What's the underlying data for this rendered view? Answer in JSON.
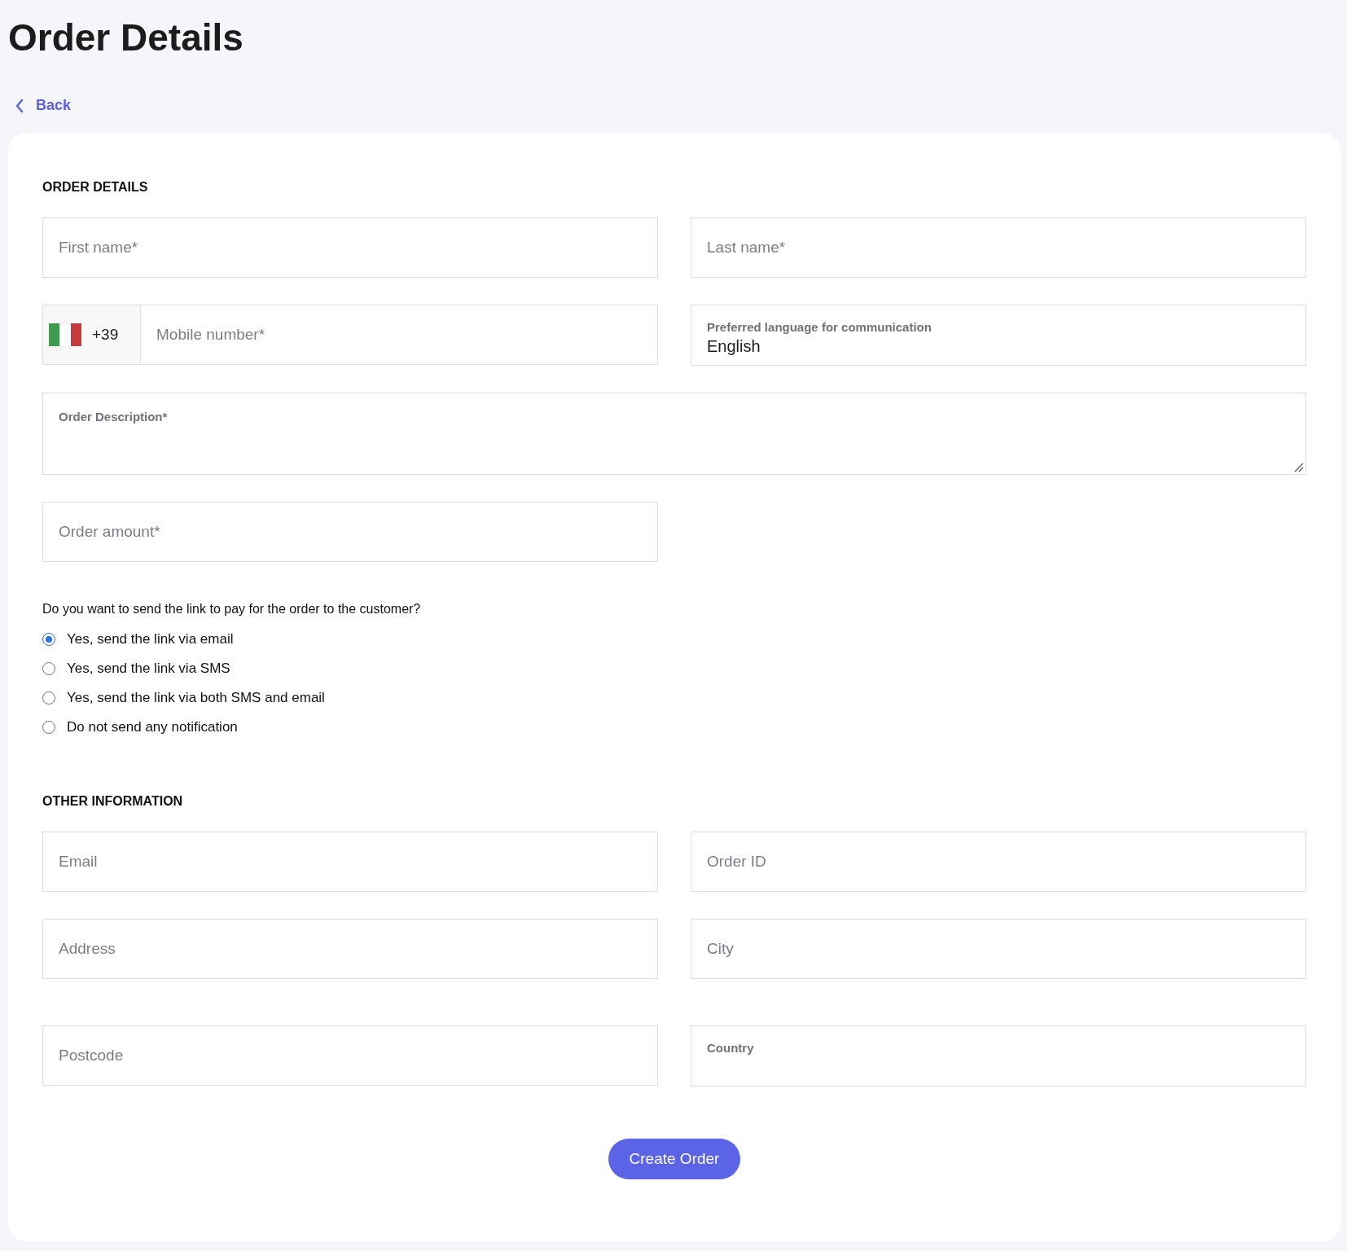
{
  "page": {
    "title": "Order Details",
    "back": "Back"
  },
  "order_details": {
    "heading": "ORDER DETAILS",
    "first_name": {
      "placeholder": "First name*"
    },
    "last_name": {
      "placeholder": "Last name*"
    },
    "mobile": {
      "country_code": "+39",
      "placeholder": "Mobile number*"
    },
    "language": {
      "label": "Preferred language for communication",
      "value": "English"
    },
    "description": {
      "label": "Order Description*"
    },
    "amount": {
      "placeholder": "Order amount*"
    },
    "question": "Do you want to send the link to pay for the order to the customer?",
    "options": [
      {
        "label": "Yes, send the link via email",
        "selected": true
      },
      {
        "label": "Yes, send the link via SMS",
        "selected": false
      },
      {
        "label": "Yes, send the link via both SMS and email",
        "selected": false
      },
      {
        "label": "Do not send any notification",
        "selected": false
      }
    ]
  },
  "other_information": {
    "heading": "OTHER INFORMATION",
    "fields": [
      {
        "kind": "input",
        "placeholder": "Email"
      },
      {
        "kind": "input",
        "placeholder": "Order ID"
      },
      {
        "kind": "input",
        "placeholder": "Address"
      },
      {
        "kind": "input",
        "placeholder": "City"
      },
      {
        "kind": "input",
        "placeholder": "Postcode"
      },
      {
        "kind": "select",
        "label": "Country"
      }
    ]
  },
  "submit": "Create Order"
}
